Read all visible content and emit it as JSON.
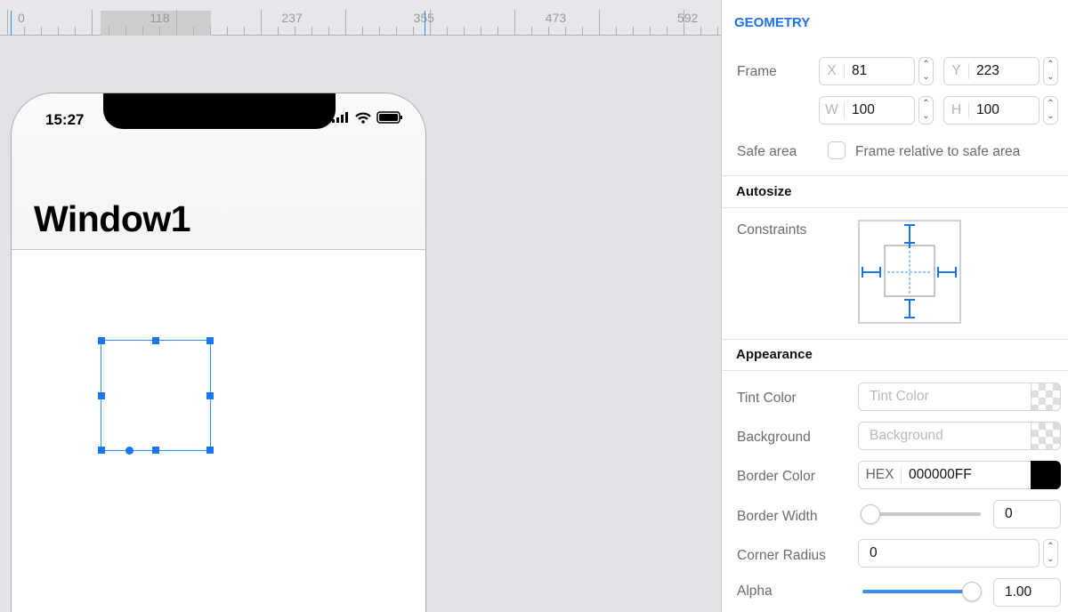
{
  "ruler": {
    "labels": [
      "0",
      "118",
      "237",
      "355",
      "473",
      "592"
    ]
  },
  "device": {
    "time": "15:27",
    "title": "Window1"
  },
  "panel": {
    "geometry_title": "GEOMETRY",
    "frame_label": "Frame",
    "x": {
      "prefix": "X",
      "value": "81"
    },
    "y": {
      "prefix": "Y",
      "value": "223"
    },
    "w": {
      "prefix": "W",
      "value": "100"
    },
    "h": {
      "prefix": "H",
      "value": "100"
    },
    "safe_area_label": "Safe area",
    "safe_area_checkbox": "Frame relative to safe area",
    "autosize_title": "Autosize",
    "constraints_label": "Constraints",
    "appearance_title": "Appearance",
    "tint_label": "Tint Color",
    "tint_placeholder": "Tint Color",
    "background_label": "Background",
    "background_placeholder": "Background",
    "border_color_label": "Border Color",
    "border_color_format": "HEX",
    "border_color_value": "000000FF",
    "border_width_label": "Border Width",
    "border_width_value": "0",
    "corner_radius_label": "Corner Radius",
    "corner_radius_value": "0",
    "alpha_label": "Alpha",
    "alpha_value": "1.00",
    "accent": "#1a73e8"
  }
}
